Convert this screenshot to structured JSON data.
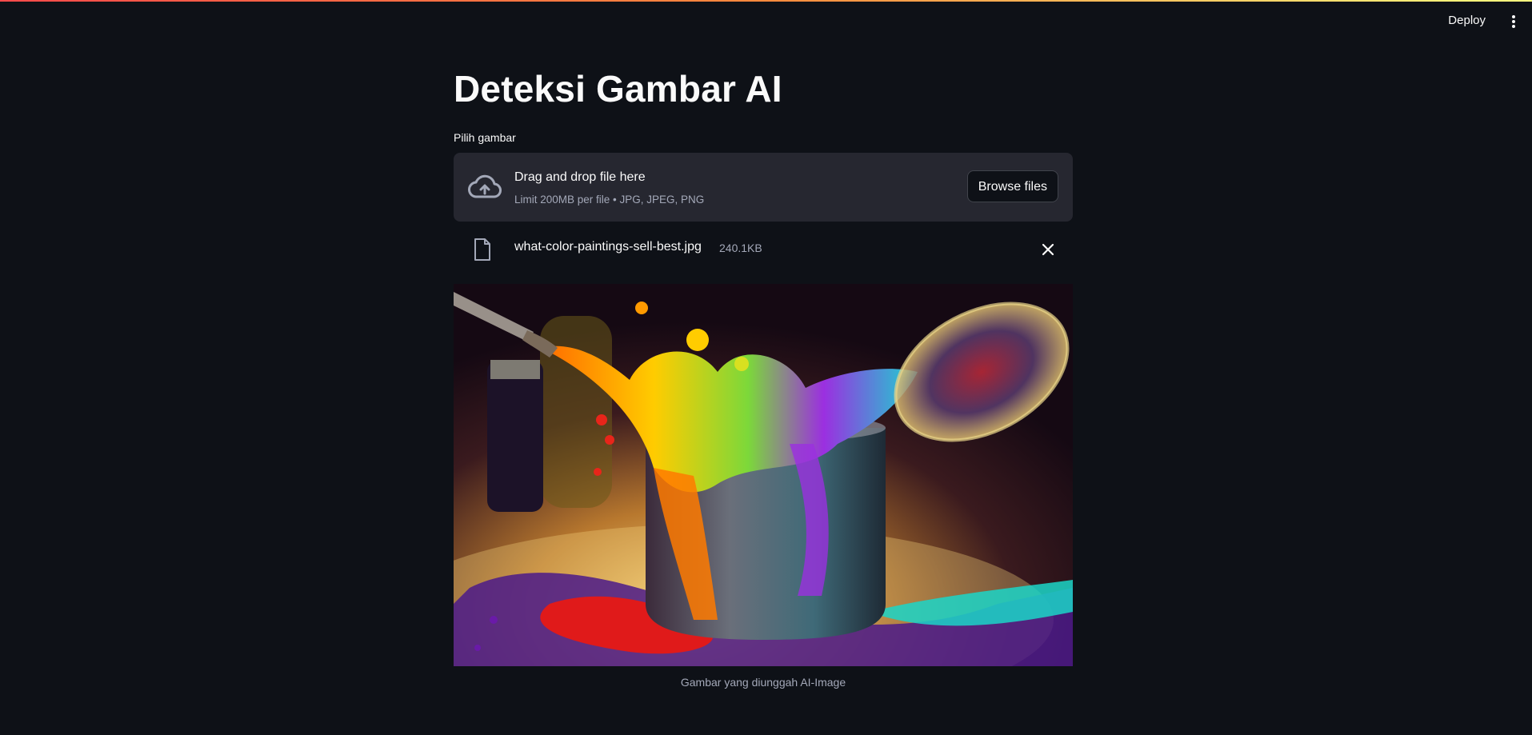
{
  "header": {
    "deploy_label": "Deploy",
    "menu_icon": "kebab-menu-icon"
  },
  "page": {
    "title": "Deteksi Gambar AI"
  },
  "uploader": {
    "label": "Pilih gambar",
    "drop_text": "Drag and drop file here",
    "limit_text": "Limit 200MB per file • JPG, JPEG, PNG",
    "browse_label": "Browse files",
    "upload_icon": "cloud-upload-icon"
  },
  "uploaded_file": {
    "name": "what-color-paintings-sell-best.jpg",
    "size": "240.1KB",
    "file_icon": "file-icon",
    "remove_icon": "close-icon"
  },
  "image": {
    "caption": "Gambar yang diunggah AI-Image"
  },
  "colors": {
    "background": "#0e1117",
    "panel": "#262730",
    "text": "#fafafa",
    "muted": "#a3a8b8",
    "accent": "#ff4b4b"
  }
}
